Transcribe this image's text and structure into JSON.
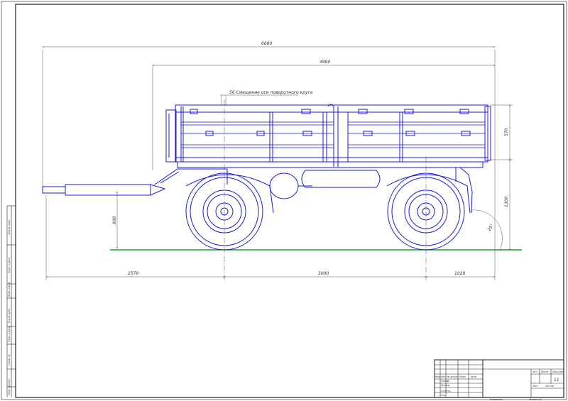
{
  "drawing": {
    "colors": {
      "outline": "#1a1ad6",
      "dimension": "#555555",
      "frame": "#222222",
      "ground": "#1f9a2a",
      "background": "#ffffff"
    },
    "dimensions": {
      "overall_length": "6680",
      "body_length": "4960",
      "offset_note": "56 Смещение оси поворотного круга",
      "side_height": "570",
      "platform_height": "1300",
      "hitch_height": "800",
      "angle": "25°",
      "drawbar_length": "2570",
      "wheelbase": "3000",
      "rear_overhang": "1020"
    },
    "margin_labels": [
      "Инв.№ подл.",
      "Подп. и дата",
      "Взам. инв.№",
      "Инв.№ дубл.",
      "Подп. и дата",
      "Справ. №",
      "Перв. примен."
    ],
    "title_block": {
      "col_headers": [
        "Изм.",
        "Лист",
        "№ докум.",
        "Подп.",
        "Дата"
      ],
      "row_labels": [
        "Разраб.",
        "Провер.",
        "",
        "Н.контр.",
        "Утв."
      ],
      "stage_headers": [
        "Лит.",
        "Масса",
        "Масштаб"
      ],
      "sheet_label": "Лист",
      "sheets_label": "Листов",
      "sheets_count": "11",
      "copied_label": "Копировал",
      "format_label": "Формат A1"
    }
  }
}
